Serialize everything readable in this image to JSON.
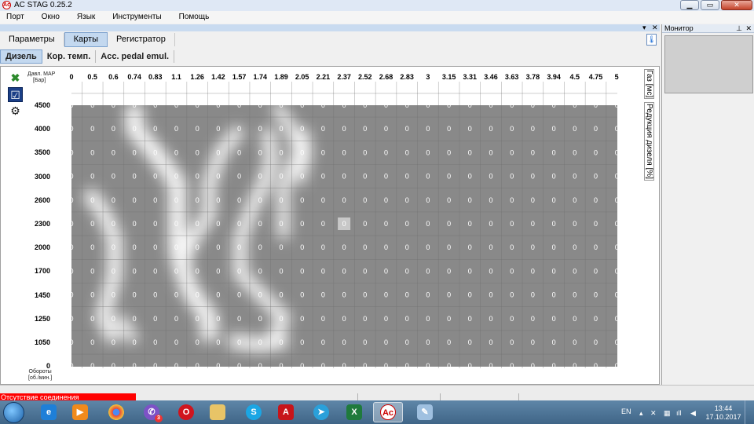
{
  "window": {
    "title": "AC STAG 0.25.2",
    "min": "▁",
    "max": "▭",
    "close": "✕"
  },
  "menu": [
    "Порт",
    "Окно",
    "Язык",
    "Инструменты",
    "Помощь"
  ],
  "strip": {
    "pin": "▾",
    "close": "✕"
  },
  "main_tabs": [
    "Параметры",
    "Карты",
    "Регистратор"
  ],
  "main_tab_active": "Карты",
  "sub_tabs": [
    "Дизель",
    "Кор. темп.",
    "Acc. pedal emul."
  ],
  "sub_tab_active": "Дизель",
  "map": {
    "x_title_line1": "Давл. MAP",
    "x_title_line2": "[Бар]",
    "y_title_line1": "Обороты",
    "y_title_line2": "[об./мин.]",
    "x_values": [
      "0",
      "0.5",
      "0.6",
      "0.74",
      "0.83",
      "1.1",
      "1.26",
      "1.42",
      "1.57",
      "1.74",
      "1.89",
      "2.05",
      "2.21",
      "2.37",
      "2.52",
      "2.68",
      "2.83",
      "3",
      "3.15",
      "3.31",
      "3.46",
      "3.63",
      "3.78",
      "3.94",
      "4.5",
      "4.75",
      "5"
    ],
    "y_values": [
      "4500",
      "4000",
      "3500",
      "3000",
      "2600",
      "2300",
      "2000",
      "1700",
      "1450",
      "1250",
      "1050",
      "0"
    ],
    "cell_value": "0",
    "selected_cell": {
      "row": 5,
      "col": 13
    }
  },
  "side_tabs": [
    "Газ [мс]",
    "Редукция дизеля [%]"
  ],
  "monitor": {
    "title": "Монитор",
    "pin": "⊥",
    "close": "✕"
  },
  "status": {
    "connection": "Отсутствие соединения"
  },
  "taskbar": {
    "apps": [
      "ie",
      "media-player",
      "chrome",
      "viber",
      "opera",
      "explorer",
      "skype",
      "acrobat",
      "telegram",
      "excel",
      "ac-stag",
      "paint"
    ],
    "viber_badge": "3",
    "active_app": "ac-stag",
    "tray_lang": "EN",
    "time": "13:44",
    "date": "17.10.2017"
  },
  "colors": {
    "accent": "#c3d8ef",
    "map_fill": "#898989",
    "status_red": "#ff0000"
  }
}
